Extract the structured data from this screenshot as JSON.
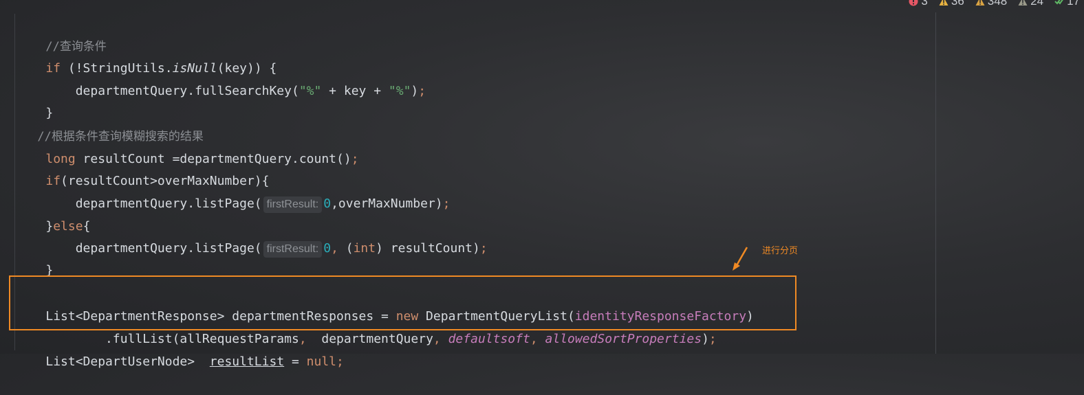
{
  "status_bar": {
    "errors": "3",
    "warnings": "36",
    "weak_warnings": "348",
    "typos": "24",
    "ok": "17"
  },
  "code": {
    "comment1": "//查询条件",
    "if_kw": "if",
    "if_cond_a": " (!StringUtils.",
    "isNull": "isNull",
    "if_cond_b": "(key)) {",
    "full_search_a": "    departmentQuery.fullSearchKey(",
    "str_pct": "\"%\"",
    "full_search_b": " + key + ",
    "full_search_c": ")",
    "semi": ";",
    "close_brace": "}",
    "comment2": "//根据条件查询模糊搜索的结果",
    "long_kw": "long",
    "count_line": " resultCount =departmentQuery.count()",
    "if2_cond": "(resultCount>overMaxNumber){",
    "list_page_a": "    departmentQuery.listPage(",
    "hint_first_result": "firstResult:",
    "zero": "0",
    "list_page_b": ",overMaxNumber)",
    "else_open": "}",
    "else_kw": "else",
    "else_brace": "{",
    "comma_space": ", ",
    "int_open": "(",
    "int_kw": "int",
    "int_close": ") resultCount)",
    "boxed_line1_a": "List<DepartmentResponse> departmentResponses = ",
    "new_kw": "new",
    "boxed_line1_b": " DepartmentQueryList(",
    "identity_factory": "identityResponseFactory",
    "boxed_line1_c": ")",
    "boxed_line2_a": "        .fullList(allRequestParams",
    "boxed_line2_b": " departmentQuery",
    "default_soft": "defaultsoft",
    "allowed_sort": "allowedSortProperties",
    "boxed_line2_c": ")",
    "last_line_a": "List<DepartUserNode>  ",
    "result_list": "resultList",
    "last_line_b": " = ",
    "null_kw": "null"
  },
  "annotation": {
    "label": "进行分页",
    "color": "#f08a24"
  }
}
